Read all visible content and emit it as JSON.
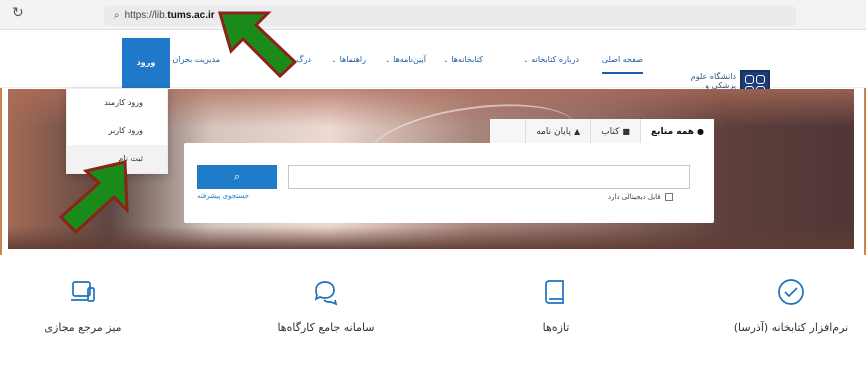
{
  "browser": {
    "url_prefix": "https://lib.",
    "url_bold": "tums.ac.ir",
    "reload_icon": "reload-icon",
    "search_icon": "search-icon"
  },
  "header": {
    "logo_text": "دانشگاه علوم پزشکی\nو خدمات بهداشتی درمانی تهران",
    "nav": [
      {
        "label": "صفحه اصلی"
      },
      {
        "label": "درباره کتابخانه"
      },
      {
        "label": "کتابخانه‌ها"
      },
      {
        "label": "آیین‌نامه‌ها"
      },
      {
        "label": "راهنماها"
      },
      {
        "label": "درگ"
      },
      {
        "label": "مدیریت بحران"
      }
    ],
    "login": "ورود"
  },
  "dropdown": {
    "items": [
      "ورود کارمند",
      "ورود کاربر",
      "ثبت نام"
    ]
  },
  "search": {
    "tabs": [
      {
        "label": "همه منابع"
      },
      {
        "label": "کتاب"
      },
      {
        "label": "پایان نامه"
      }
    ],
    "button_icon": "search-icon",
    "advanced": "جستجوی پیشرفته",
    "digital_filter": "فایل دیجیتالی دارد"
  },
  "features": [
    {
      "label": "میز مرجع مجازی",
      "icon": "devices-icon"
    },
    {
      "label": "سامانه جامع کارگاه‌ها",
      "icon": "chat-icon"
    },
    {
      "label": "تازه‌ها",
      "icon": "book-icon"
    },
    {
      "label": "نرم‌افزار کتابخانه (آذرسا)",
      "icon": "check-circle-icon"
    }
  ],
  "colors": {
    "accent": "#1f7cc8",
    "arrow_green": "#1a8b1b",
    "arrow_red": "#8c2318",
    "frame": "#c7874e"
  }
}
